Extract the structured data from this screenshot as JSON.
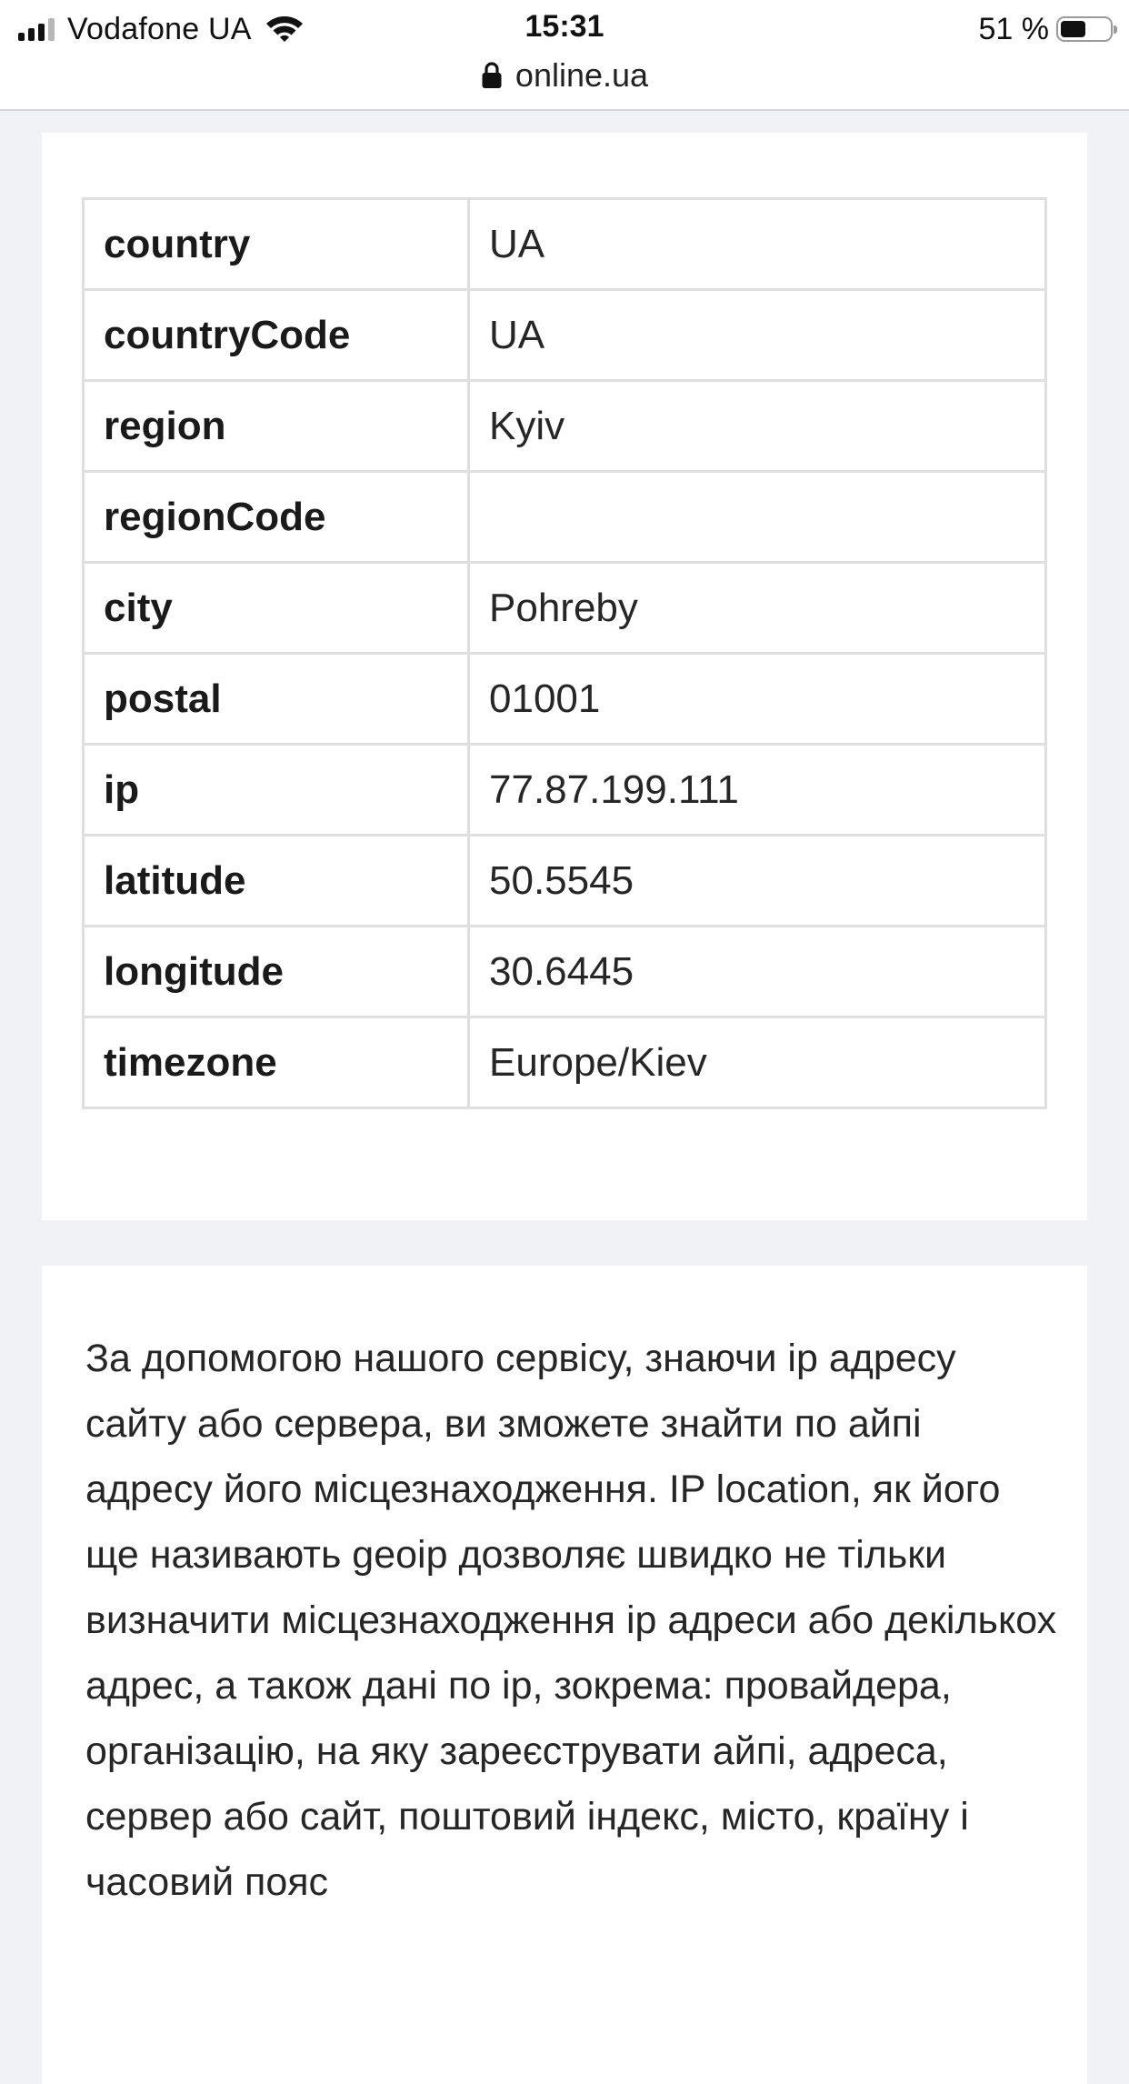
{
  "status_bar": {
    "carrier": "Vodafone UA",
    "time": "15:31",
    "battery_percent": "51 %",
    "battery_level": 0.51,
    "signal_bars": 3,
    "signal_bars_total": 4
  },
  "browser": {
    "url": "online.ua"
  },
  "geo_table": {
    "rows": [
      {
        "key": "country",
        "value": "UA"
      },
      {
        "key": "countryCode",
        "value": "UA"
      },
      {
        "key": "region",
        "value": "Kyiv"
      },
      {
        "key": "regionCode",
        "value": ""
      },
      {
        "key": "city",
        "value": "Pohreby"
      },
      {
        "key": "postal",
        "value": "01001"
      },
      {
        "key": "ip",
        "value": "77.87.199.111"
      },
      {
        "key": "latitude",
        "value": "50.5545"
      },
      {
        "key": "longitude",
        "value": "30.6445"
      },
      {
        "key": "timezone",
        "value": "Europe/Kiev"
      }
    ]
  },
  "description": {
    "text": "За допомогою нашого сервісу, знаючи ip адресу сайту або сервера, ви зможете знайти по айпі адресу його місцезнаходження. IP location, як його ще називають geoip дозволяє швидко не тільки визначити місцезнаходження ip адреси або декількох адрес, а також дані по ip, зокрема: провайдера, організацію, на яку зареєструвати айпі, адреса, сервер або сайт, поштовий індекс, місто, країну і часовий пояс"
  },
  "icons": {
    "signal": "cellular-signal-icon",
    "wifi": "wifi-icon",
    "battery": "battery-icon",
    "lock": "lock-icon"
  }
}
